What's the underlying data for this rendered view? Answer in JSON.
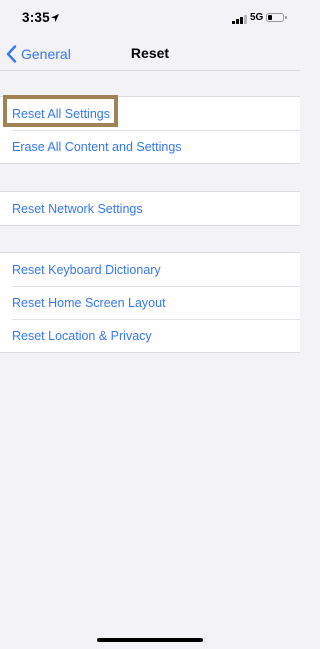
{
  "status_bar": {
    "time": "3:35",
    "network": "5G",
    "battery_level": 0.25
  },
  "nav": {
    "back_label": "General",
    "title": "Reset"
  },
  "groups": [
    {
      "items": [
        {
          "label": "Reset All Settings",
          "highlighted": true
        },
        {
          "label": "Erase All Content and Settings"
        }
      ]
    },
    {
      "items": [
        {
          "label": "Reset Network Settings"
        }
      ]
    },
    {
      "items": [
        {
          "label": "Reset Keyboard Dictionary"
        },
        {
          "label": "Reset Home Screen Layout"
        },
        {
          "label": "Reset Location & Privacy"
        }
      ]
    }
  ],
  "colors": {
    "accent": "#3478f6",
    "highlight_border": "#a08256",
    "background": "#f2f2f7"
  },
  "icons": {
    "back": "chevron-left-icon",
    "location": "location-arrow-icon",
    "signal": "cellular-signal-icon",
    "battery": "battery-icon"
  }
}
